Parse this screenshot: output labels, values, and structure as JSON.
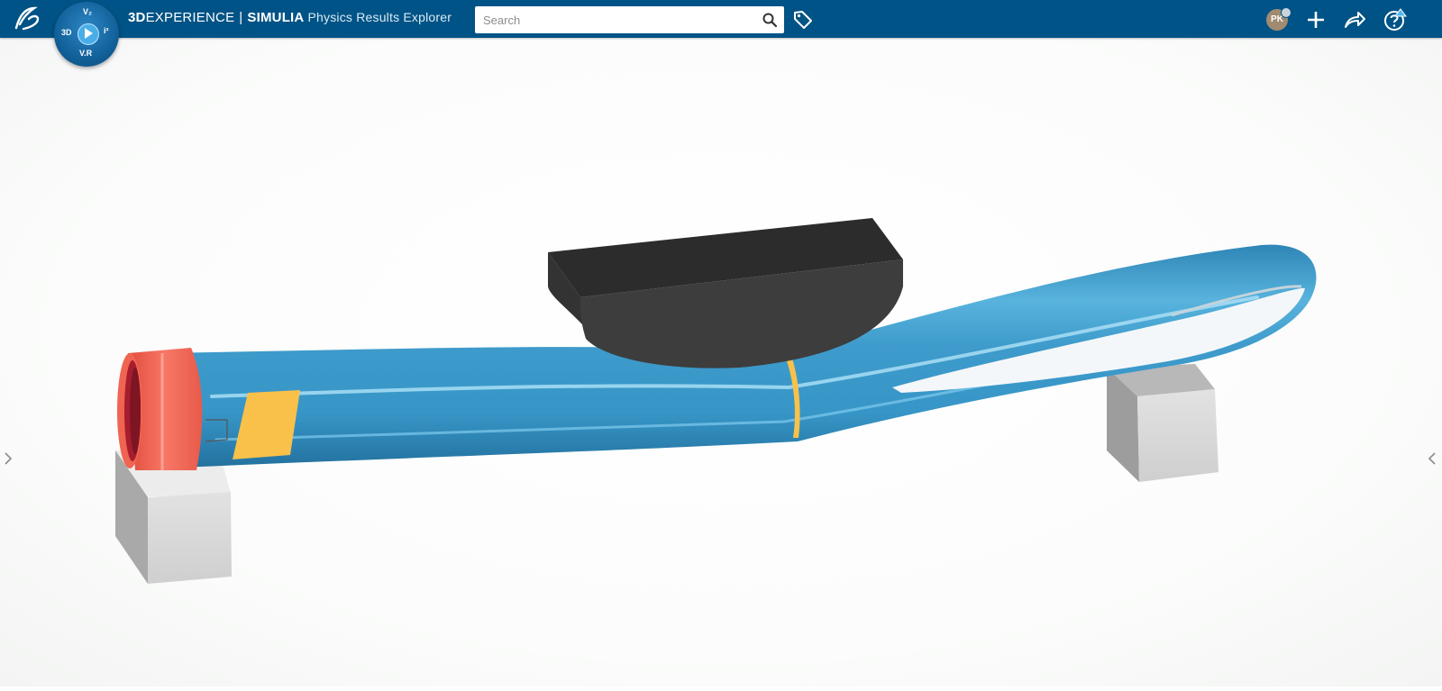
{
  "header": {
    "brand_bold": "3D",
    "brand_rest": "EXPERIENCE",
    "separator": "|",
    "product": "SIMULIA",
    "app_name": "Physics Results Explorer",
    "compass": {
      "top": "V₂",
      "left": "3D",
      "right": "i²",
      "bottom": "V.R"
    },
    "avatar_initials": "PK"
  },
  "search": {
    "placeholder": "Search",
    "value": ""
  },
  "icons": {
    "logo": "ds-logo-icon",
    "search": "search-icon",
    "tag": "tag-icon",
    "add": "plus-icon",
    "share": "share-icon",
    "help": "help-icon",
    "left_panel": "chevron-right-icon",
    "right_panel": "chevron-left-icon"
  },
  "colors": {
    "header_bg": "#005386",
    "pipe_blue": "#3a9ac9",
    "end_cap_red": "#f0604f",
    "marker_yellow": "#f9c14a",
    "impactor_dark": "#3b3b3b",
    "support_gray": "#d4d4d4"
  }
}
